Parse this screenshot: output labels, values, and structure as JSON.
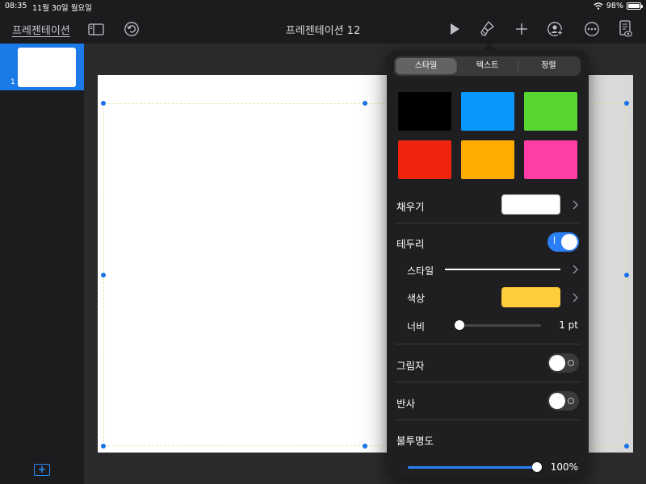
{
  "status_bar": {
    "time": "08:35",
    "date": "11월 30일 월요일",
    "battery": "98%"
  },
  "toolbar": {
    "back_label": "프레젠테이션",
    "title": "프레젠테이션 12",
    "icons": [
      "sidebar-icon",
      "undo-icon",
      "play-icon",
      "format-brush-icon",
      "add-icon",
      "collaborate-icon",
      "more-icon",
      "presenter-notes-icon"
    ]
  },
  "slides": [
    {
      "number": "1"
    }
  ],
  "format_panel": {
    "tabs": [
      {
        "label": "스타일",
        "active": true
      },
      {
        "label": "텍스트",
        "active": false
      },
      {
        "label": "정렬",
        "active": false
      }
    ],
    "style_swatches": [
      "#000000",
      "#0a98ff",
      "#5ad632",
      "#f0230f",
      "#ffac00",
      "#ff3ea5"
    ],
    "fill": {
      "label": "채우기",
      "color": "#ffffff"
    },
    "border": {
      "label": "테두리",
      "enabled": true,
      "style_label": "스타일",
      "color_label": "색상",
      "color": "#ffcd3b",
      "width_label": "너비",
      "width_value": "1 pt",
      "width_level": 0.0
    },
    "shadow": {
      "label": "그림자",
      "enabled": false
    },
    "reflection": {
      "label": "반사",
      "enabled": false
    },
    "opacity": {
      "label": "불투명도",
      "value": "100%",
      "level": 1.0
    }
  },
  "colors": {
    "accent": "#2a7ff5",
    "panel": "#1f1f21",
    "background": "#1c1c1e"
  }
}
